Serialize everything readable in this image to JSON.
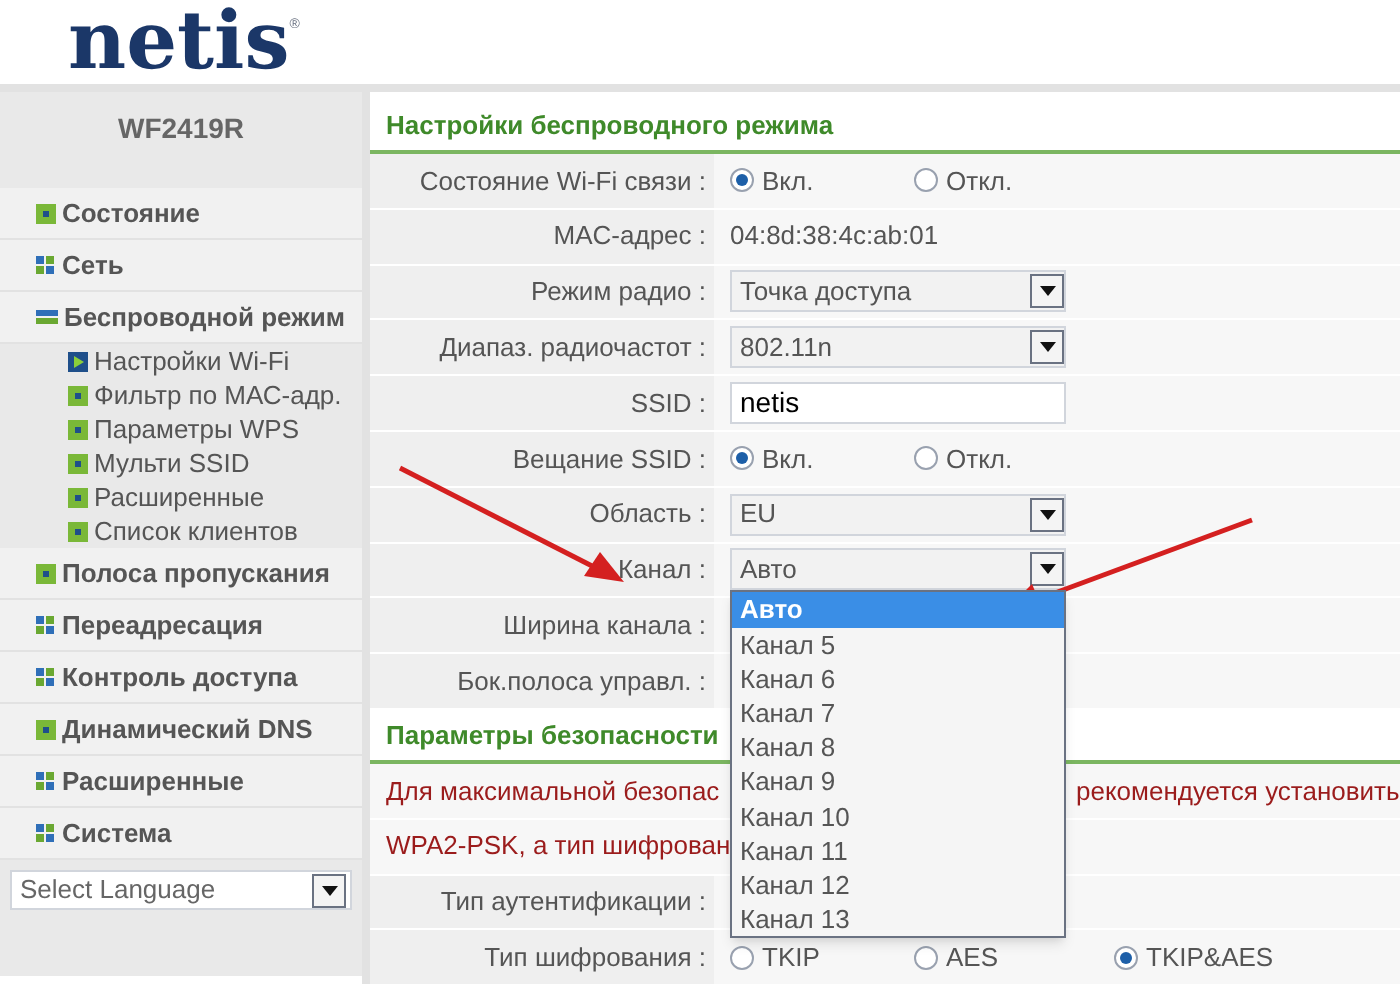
{
  "header": {
    "logo": "netis",
    "logo_mark": "®"
  },
  "sidebar": {
    "model": "WF2419R",
    "items": [
      {
        "label": "Состояние",
        "kind": "leaf"
      },
      {
        "label": "Сеть",
        "kind": "folder",
        "expanded": false
      },
      {
        "label": "Беспроводной режим",
        "kind": "folder",
        "expanded": true,
        "children": [
          {
            "label": "Настройки Wi-Fi",
            "selected": true
          },
          {
            "label": "Фильтр по МАС-адр.",
            "selected": false
          },
          {
            "label": "Параметры WPS",
            "selected": false
          },
          {
            "label": "Мульти SSID",
            "selected": false
          },
          {
            "label": "Расширенные",
            "selected": false
          },
          {
            "label": "Список клиентов",
            "selected": false
          }
        ]
      },
      {
        "label": "Полоса пропускания",
        "kind": "leaf"
      },
      {
        "label": "Переадресация",
        "kind": "folder",
        "expanded": false
      },
      {
        "label": "Контроль доступа",
        "kind": "folder",
        "expanded": false
      },
      {
        "label": "Динамический DNS",
        "kind": "leaf"
      },
      {
        "label": "Расширенные",
        "kind": "folder",
        "expanded": false
      },
      {
        "label": "Система",
        "kind": "folder",
        "expanded": false
      }
    ],
    "language": {
      "value": "Select Language"
    }
  },
  "wireless": {
    "title": "Настройки беспроводного режима",
    "rows": [
      {
        "label": "Состояние Wi-Fi связи :",
        "kind": "radio",
        "options": [
          {
            "label": "Вкл.",
            "selected": true
          },
          {
            "label": "Откл.",
            "selected": false
          }
        ]
      },
      {
        "label": "MAC-адрес :",
        "kind": "text",
        "value": "04:8d:38:4c:ab:01"
      },
      {
        "label": "Режим радио :",
        "kind": "select",
        "value": "Точка доступа"
      },
      {
        "label": "Диапаз. радиочастот :",
        "kind": "select",
        "value": "802.11n"
      },
      {
        "label": "SSID :",
        "kind": "input",
        "value": "netis"
      },
      {
        "label": "Вещание SSID :",
        "kind": "radio",
        "options": [
          {
            "label": "Вкл.",
            "selected": true
          },
          {
            "label": "Откл.",
            "selected": false
          }
        ]
      },
      {
        "label": "Область :",
        "kind": "select",
        "value": "EU"
      },
      {
        "label": "Канал :",
        "kind": "select",
        "value": "Авто",
        "open": true,
        "options": [
          {
            "label": "Авто",
            "selected": true
          },
          {
            "label": "Канал 5",
            "selected": false
          },
          {
            "label": "Канал 6",
            "selected": false
          },
          {
            "label": "Канал 7",
            "selected": false
          },
          {
            "label": "Канал 8",
            "selected": false
          },
          {
            "label": "Канал 9",
            "selected": false
          },
          {
            "label": "Канал 10",
            "selected": false
          },
          {
            "label": "Канал 11",
            "selected": false
          },
          {
            "label": "Канал 12",
            "selected": false
          },
          {
            "label": "Канал 13",
            "selected": false
          }
        ]
      },
      {
        "label": "Ширина канала :",
        "kind": "empty"
      },
      {
        "label": "Бок.полоса управл. :",
        "kind": "empty"
      }
    ]
  },
  "security": {
    "title": "Параметры безопасности",
    "notes": [
      {
        "left": "Для максимальной безопас",
        "right": "рекомендуется установить"
      },
      {
        "left": "WPA2-PSK, а тип шифрован"
      }
    ],
    "rows": [
      {
        "label": "Тип аутентификации :",
        "kind": "empty"
      },
      {
        "label": "Тип шифрования :",
        "kind": "radio",
        "options": [
          {
            "label": "TKIP",
            "selected": false
          },
          {
            "label": "AES",
            "selected": false
          },
          {
            "label": "TKIP&AES",
            "selected": true
          }
        ]
      }
    ]
  }
}
